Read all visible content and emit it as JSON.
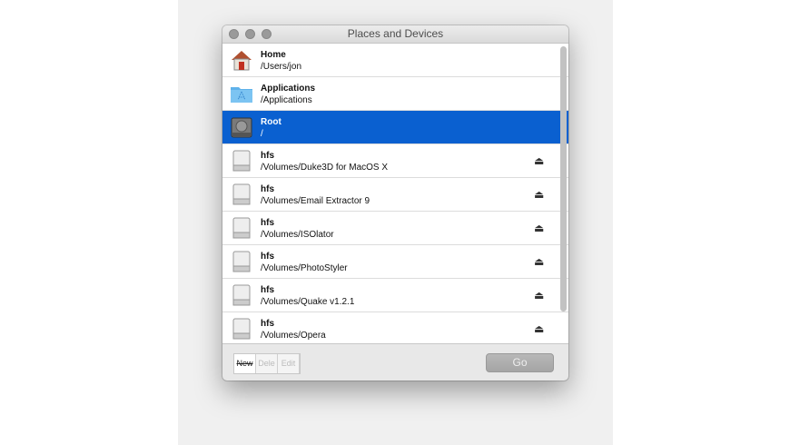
{
  "window": {
    "title": "Places and Devices"
  },
  "rows": [
    {
      "name": "Home",
      "path": "/Users/jon",
      "icon": "home-icon",
      "eject": false
    },
    {
      "name": "Applications",
      "path": "/Applications",
      "icon": "applications-folder-icon",
      "eject": false
    },
    {
      "name": "Root",
      "path": "/",
      "icon": "hard-disk-icon",
      "eject": false,
      "selected": true
    },
    {
      "name": "hfs",
      "path": "/Volumes/Duke3D for MacOS X",
      "icon": "disk-image-icon",
      "eject": true
    },
    {
      "name": "hfs",
      "path": "/Volumes/Email Extractor 9",
      "icon": "disk-image-icon",
      "eject": true
    },
    {
      "name": "hfs",
      "path": "/Volumes/ISOlator",
      "icon": "disk-image-icon",
      "eject": true
    },
    {
      "name": "hfs",
      "path": "/Volumes/PhotoStyler",
      "icon": "disk-image-icon",
      "eject": true
    },
    {
      "name": "hfs",
      "path": "/Volumes/Quake v1.2.1",
      "icon": "disk-image-icon",
      "eject": true
    },
    {
      "name": "hfs",
      "path": "/Volumes/Opera",
      "icon": "disk-image-icon",
      "eject": true
    }
  ],
  "eject_glyph": "⏏",
  "toolbar": {
    "new_label": "New",
    "delete_label": "Dele",
    "edit_label": "Edit",
    "go_label": "Go"
  },
  "colors": {
    "selection": "#0a60d0"
  }
}
